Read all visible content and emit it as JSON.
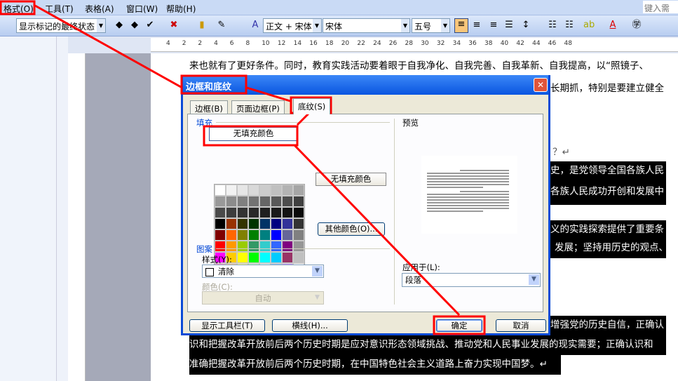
{
  "menubar": {
    "items": [
      "格式(O)",
      "工具(T)",
      "表格(A)",
      "窗口(W)",
      "帮助(H)"
    ],
    "help_placeholder": "键入需要"
  },
  "toolbar": {
    "markup_state": "显示标记的最终状态",
    "style": "正文 + 宋体",
    "font": "宋体",
    "size": "五号"
  },
  "ruler": {
    "ticks": [
      "4",
      "2",
      "2",
      "4",
      "6",
      "8",
      "10",
      "12",
      "14",
      "16",
      "18",
      "20",
      "22",
      "24",
      "26",
      "28",
      "30",
      "32",
      "34",
      "36",
      "38",
      "40",
      "42",
      "44",
      "46",
      "48"
    ]
  },
  "document": {
    "line1": "来也就有了更好条件。同时，教育实践活动要着眼于自我净化、自我完善、自我革新、自我提高，以“照镜子、",
    "line2": "长期抓，特别是要建立健全",
    "line3": "？↵",
    "hl1": "史，是党领导全国各族人民",
    "hl2": "各族人民成功开创和发展中",
    "hl3": "义的实践探索提供了重要条",
    "hl4": "发展；坚持用历史的观点、",
    "hl5": "增强党的历史自信，正确认",
    "hl6": "识和把握改革开放前后两个历史时期是应对意识形态领域挑战、推动党和人民事业发展的现实需要；正确认识和",
    "hl7": "准确把握改革开放前后两个历史时期，在中国特色社会主义道路上奋力实现中国梦。↵"
  },
  "dialog": {
    "title": "边框和底纹",
    "tabs": [
      "边框(B)",
      "页面边框(P)",
      "底纹(S)"
    ],
    "active_tab": "底纹(S)",
    "fill_label": "填充",
    "no_fill_button": "无填充颜色",
    "no_fill_display": "无填充颜色",
    "more_colors": "其他颜色(O)...",
    "pattern_label": "图案",
    "style_label": "样式(Y):",
    "style_value": "清除",
    "color_label": "颜色(C):",
    "color_value": "自动",
    "preview_label": "预览",
    "apply_label": "应用于(L):",
    "apply_value": "段落",
    "show_toolbar": "显示工具栏(T)",
    "horizontal_line": "横线(H)...",
    "ok": "确定",
    "cancel": "取消",
    "palette": [
      "#ffffff",
      "#f2f2f2",
      "#e6e6e6",
      "#d9d9d9",
      "#cccccc",
      "#c0c0c0",
      "#b3b3b3",
      "#a6a6a6",
      "#999999",
      "#8c8c8c",
      "#808080",
      "#737373",
      "#666666",
      "#595959",
      "#4d4d4d",
      "#404040",
      "#4a4a4a",
      "#3d3d3d",
      "#333333",
      "#292929",
      "#1f1f1f",
      "#1a1a1a",
      "#141414",
      "#0a0a0a",
      "#000000",
      "#993300",
      "#333300",
      "#003300",
      "#003366",
      "#000080",
      "#333399",
      "#333333",
      "#800000",
      "#ff6600",
      "#808000",
      "#008000",
      "#008080",
      "#0000ff",
      "#666699",
      "#808080",
      "#ff0000",
      "#ff9900",
      "#99cc00",
      "#339966",
      "#33cccc",
      "#3366ff",
      "#800080",
      "#969696",
      "#ff00ff",
      "#ffcc00",
      "#ffff00",
      "#00ff00",
      "#00ffff",
      "#00ccff",
      "#993366",
      "#c0c0c0",
      "#ff99cc",
      "#ffcc99",
      "#ffff99",
      "#ccffcc",
      "#ccffff",
      "#99ccff",
      "#cc99ff",
      "#ffffff"
    ]
  },
  "colors": {
    "annotation": "#ff0000",
    "titlebar": "#0a56e0"
  }
}
